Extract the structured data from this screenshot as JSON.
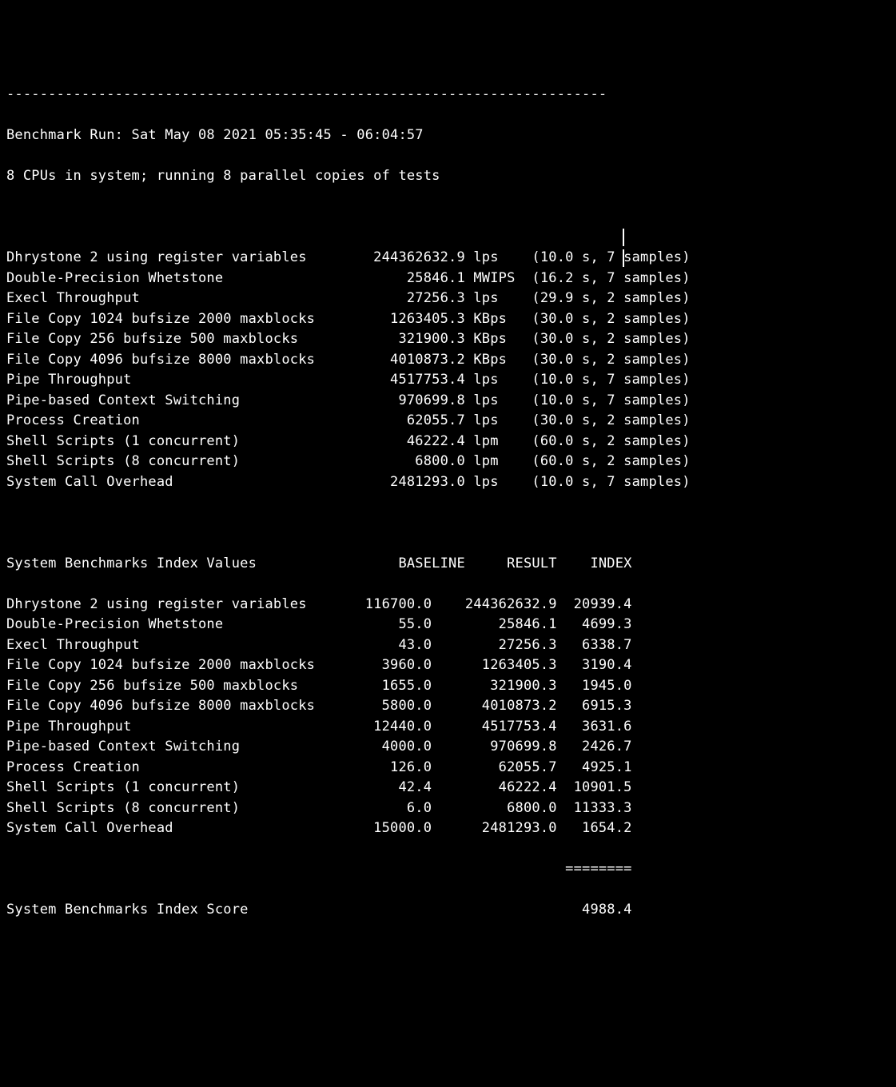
{
  "divider": "------------------------------------------------------------------------",
  "run_header": "Benchmark Run: Sat May 08 2021 05:35:45 - 06:04:57",
  "cpu_line": "8 CPUs in system; running 8 parallel copies of tests",
  "tests": [
    {
      "name": "Dhrystone 2 using register variables",
      "value": "244362632.9",
      "unit": "lps",
      "time": "10.0",
      "samples": "7"
    },
    {
      "name": "Double-Precision Whetstone",
      "value": "25846.1",
      "unit": "MWIPS",
      "time": "16.2",
      "samples": "7"
    },
    {
      "name": "Execl Throughput",
      "value": "27256.3",
      "unit": "lps",
      "time": "29.9",
      "samples": "2"
    },
    {
      "name": "File Copy 1024 bufsize 2000 maxblocks",
      "value": "1263405.3",
      "unit": "KBps",
      "time": "30.0",
      "samples": "2"
    },
    {
      "name": "File Copy 256 bufsize 500 maxblocks",
      "value": "321900.3",
      "unit": "KBps",
      "time": "30.0",
      "samples": "2"
    },
    {
      "name": "File Copy 4096 bufsize 8000 maxblocks",
      "value": "4010873.2",
      "unit": "KBps",
      "time": "30.0",
      "samples": "2"
    },
    {
      "name": "Pipe Throughput",
      "value": "4517753.4",
      "unit": "lps",
      "time": "10.0",
      "samples": "7"
    },
    {
      "name": "Pipe-based Context Switching",
      "value": "970699.8",
      "unit": "lps",
      "time": "10.0",
      "samples": "7"
    },
    {
      "name": "Process Creation",
      "value": "62055.7",
      "unit": "lps",
      "time": "30.0",
      "samples": "2"
    },
    {
      "name": "Shell Scripts (1 concurrent)",
      "value": "46222.4",
      "unit": "lpm",
      "time": "60.0",
      "samples": "2"
    },
    {
      "name": "Shell Scripts (8 concurrent)",
      "value": "6800.0",
      "unit": "lpm",
      "time": "60.0",
      "samples": "2"
    },
    {
      "name": "System Call Overhead",
      "value": "2481293.0",
      "unit": "lps",
      "time": "10.0",
      "samples": "7"
    }
  ],
  "index_header_label": "System Benchmarks Index Values",
  "index_header_cols": {
    "baseline": "BASELINE",
    "result": "RESULT",
    "index": "INDEX"
  },
  "index": [
    {
      "name": "Dhrystone 2 using register variables",
      "baseline": "116700.0",
      "result": "244362632.9",
      "index": "20939.4"
    },
    {
      "name": "Double-Precision Whetstone",
      "baseline": "55.0",
      "result": "25846.1",
      "index": "4699.3"
    },
    {
      "name": "Execl Throughput",
      "baseline": "43.0",
      "result": "27256.3",
      "index": "6338.7"
    },
    {
      "name": "File Copy 1024 bufsize 2000 maxblocks",
      "baseline": "3960.0",
      "result": "1263405.3",
      "index": "3190.4"
    },
    {
      "name": "File Copy 256 bufsize 500 maxblocks",
      "baseline": "1655.0",
      "result": "321900.3",
      "index": "1945.0"
    },
    {
      "name": "File Copy 4096 bufsize 8000 maxblocks",
      "baseline": "5800.0",
      "result": "4010873.2",
      "index": "6915.3"
    },
    {
      "name": "Pipe Throughput",
      "baseline": "12440.0",
      "result": "4517753.4",
      "index": "3631.6"
    },
    {
      "name": "Pipe-based Context Switching",
      "baseline": "4000.0",
      "result": "970699.8",
      "index": "2426.7"
    },
    {
      "name": "Process Creation",
      "baseline": "126.0",
      "result": "62055.7",
      "index": "4925.1"
    },
    {
      "name": "Shell Scripts (1 concurrent)",
      "baseline": "42.4",
      "result": "46222.4",
      "index": "10901.5"
    },
    {
      "name": "Shell Scripts (8 concurrent)",
      "baseline": "6.0",
      "result": "6800.0",
      "index": "11333.3"
    },
    {
      "name": "System Call Overhead",
      "baseline": "15000.0",
      "result": "2481293.0",
      "index": "1654.2"
    }
  ],
  "score_divider": "                                                                   ========",
  "score_label": "System Benchmarks Index Score",
  "score_value": "4988.4"
}
